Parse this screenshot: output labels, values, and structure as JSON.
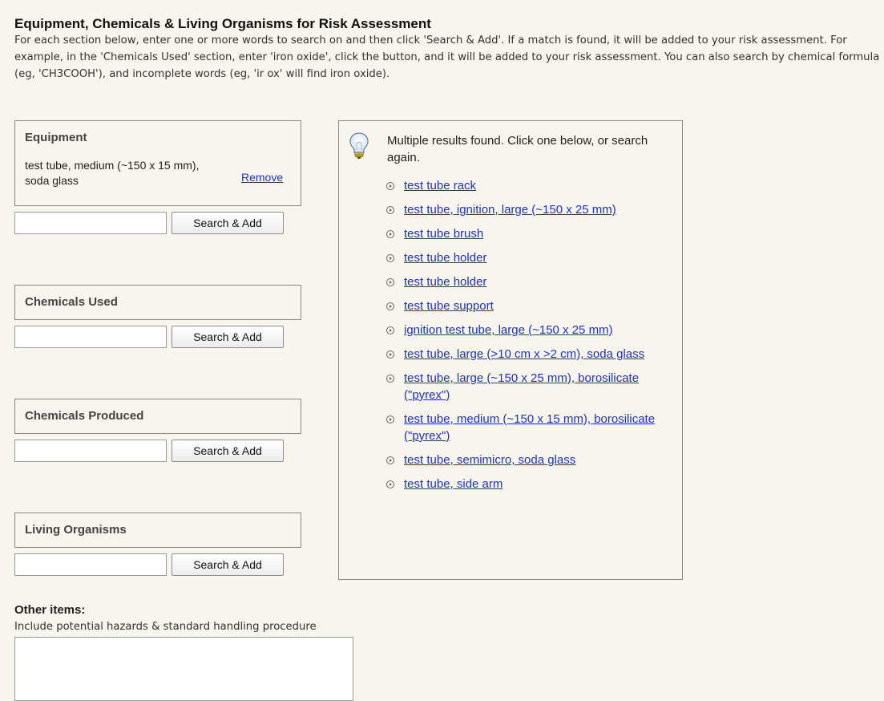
{
  "page": {
    "title": "Equipment, Chemicals & Living Organisms for Risk Assessment",
    "intro": "For each section below, enter one or more words to search on and then click 'Search & Add'. If a match is found, it will be added to your risk assessment. For example, in the 'Chemicals Used' section, enter 'iron oxide', click the button, and it will be added to your risk assessment. You can also search by chemical formula (eg, 'CH3COOH'), and incomplete words (eg, 'ir ox' will find iron oxide)."
  },
  "sections": [
    {
      "title": "Equipment",
      "added_item": "test tube, medium (~150 x 15 mm), soda glass",
      "remove_label": "Remove",
      "search_value": "",
      "button_label": "Search & Add"
    },
    {
      "title": "Chemicals Used",
      "search_value": "",
      "button_label": "Search & Add"
    },
    {
      "title": "Chemicals Produced",
      "search_value": "",
      "button_label": "Search & Add"
    },
    {
      "title": "Living Organisms",
      "search_value": "",
      "button_label": "Search & Add"
    }
  ],
  "results": {
    "icon": "lightbulb-icon",
    "message": "Multiple results found. Click one below, or search again.",
    "items": [
      "test tube rack",
      "test tube, ignition, large (~150 x 25 mm)",
      "test tube brush",
      "test tube holder",
      "test tube holder",
      "test tube support",
      "ignition test tube, large (~150 x 25 mm)",
      "test tube, large (>10 cm x >2 cm), soda glass",
      "test tube, large (~150 x 25 mm), borosilicate (\"pyrex\")",
      "test tube, medium (~150 x 15 mm), borosilicate (\"pyrex\")",
      "test tube, semimicro, soda glass",
      "test tube, side arm"
    ]
  },
  "other": {
    "title": "Other items:",
    "description": "Include potential hazards & standard handling procedure",
    "value": ""
  },
  "colors": {
    "background": "#f8f4ee",
    "link": "#1a33cc",
    "border": "#888888"
  }
}
